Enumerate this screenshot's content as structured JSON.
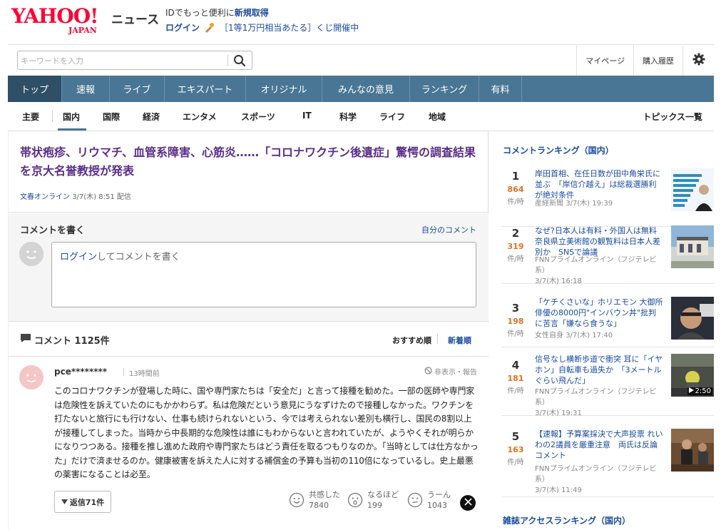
{
  "header": {
    "logo_text": "YAHOO!",
    "logo_sub": "JAPAN",
    "service": "ニュース",
    "promo_line1_prefix": "IDでもっと便利に",
    "promo_line1_link": "新規取得",
    "promo_login": "ログイン",
    "promo_lottery": "［1等1万円相当あたる］くじ開催中"
  },
  "search": {
    "placeholder": "キーワードを入力",
    "mypage": "マイページ",
    "history": "購入履歴"
  },
  "mainnav": [
    "トップ",
    "速報",
    "ライブ",
    "エキスパート",
    "オリジナル",
    "みんなの意見",
    "ランキング",
    "有料"
  ],
  "subnav": {
    "items": [
      "主要",
      "国内",
      "国際",
      "経済",
      "エンタメ",
      "スポーツ",
      "IT",
      "科学",
      "ライフ",
      "地域"
    ],
    "topics": "トピックス一覧"
  },
  "article": {
    "title": "帯状疱疹、リウマチ、血管系障害、心筋炎……「コロナワクチン後遺症」驚愕の調査結果を京大名誉教授が発表",
    "source": "文春オンライン",
    "date": "3/7(木) 8:51 配信"
  },
  "compose": {
    "label": "コメントを書く",
    "my_comments": "自分のコメント",
    "login": "ログイン",
    "prompt": "してコメントを書く"
  },
  "comments_header": {
    "title": "コメント 1125件",
    "sort_recommended": "おすすめ順",
    "sort_newest": "新着順"
  },
  "comment": {
    "user": "pce********",
    "time": "13時間前",
    "report": "非表示・報告",
    "body": "このコロナワクチンが登場した時に、国や専門家たちは「安全だ」と言って接種を勧めた。一部の医師や専門家は危険性を訴えていたのにもかかわらず。私は危険だという意見にうなずけたので接種しなかった。ワクチンを打たないと旅行にも行けない、仕事も続けられないという、今では考えられない差別も横行し、国民の8割以上が接種してしまった。当時から中長期的な危険性は誰にもわからないと言われていたが、ようやくそれが明らかになりつつある。接種を推し進めた政府や専門家たちはどう責任を取るつもりなのか。「当時としては仕方なかった」だけで済ませるのか。健康被害を訴えた人に対する補償金の予算も当初の110倍になっているし。史上最悪の薬害になることは必至。",
    "reply": "返信71件",
    "reactions": [
      {
        "label": "共感した",
        "count": "7840",
        "icon": "smile-icon"
      },
      {
        "label": "なるほど",
        "count": "199",
        "icon": "surprise-icon"
      },
      {
        "label": "うーん",
        "count": "1043",
        "icon": "hmm-icon"
      }
    ]
  },
  "ranking": {
    "title": "コメントランキング（国内）",
    "unit": "件/時",
    "items": [
      {
        "rank": "1",
        "count": "864",
        "headline": "岸田首相、在任日数が田中角栄氏に並ぶ　「岸信介越え」は総裁選勝利が絶対条件",
        "source": "産経新聞",
        "date": "3/7(木) 19:39"
      },
      {
        "rank": "2",
        "count": "319",
        "headline": "なぜ?日本人は有料・外国人は無料 奈良県立美術館の観覧料は日本人差別か　SNSで論議",
        "source": "FNNプライムオンライン（フジテレビ系）",
        "date": "3/7(木) 16:18"
      },
      {
        "rank": "3",
        "count": "198",
        "headline": "「ケチくさいな」ホリエモン 大御所俳優の8000円\"インバウン丼\"批判に苦言「嫌なら食うな」",
        "source": "女性自身",
        "date": "3/7(木) 17:40"
      },
      {
        "rank": "4",
        "count": "181",
        "headline": "信号なし横断歩道で衝突 耳に「イヤホン」自転車も過失か　「3メートルぐらい飛んだ」",
        "source": "FNNプライムオンライン（フジテレビ系）",
        "date": "3/7(木) 19:31",
        "duration": "2:50"
      },
      {
        "rank": "5",
        "count": "163",
        "headline": "【速報】予算案採決で大声投票 れいわの2議員を厳重注意　両氏は反論コメント",
        "source": "FNNプライムオンライン（フジテレビ系）",
        "date": "3/7(木) 11:49"
      }
    ],
    "next_title": "雑誌アクセスランキング（国内）"
  }
}
